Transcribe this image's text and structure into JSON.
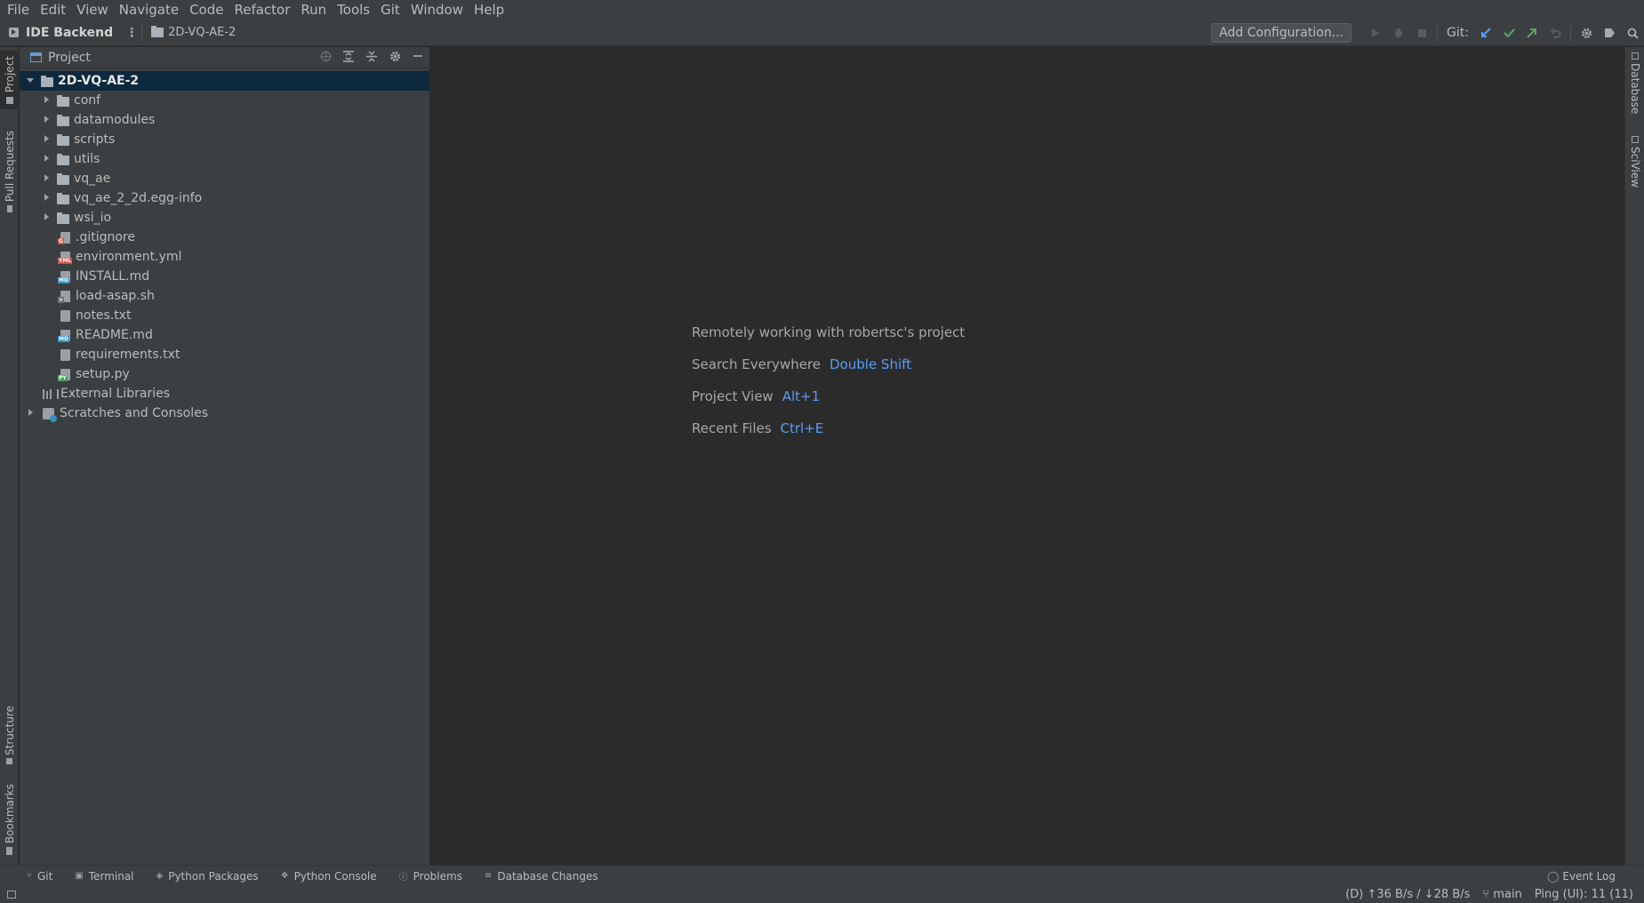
{
  "menu": [
    "File",
    "Edit",
    "View",
    "Navigate",
    "Code",
    "Refactor",
    "Run",
    "Tools",
    "Git",
    "Window",
    "Help"
  ],
  "navbar": {
    "backend_label": "IDE Backend",
    "kebab": "⋮",
    "breadcrumb": "2D-VQ-AE-2",
    "add_configuration": "Add Configuration...",
    "git_label": "Git:"
  },
  "left_stripe": {
    "project": "Project",
    "pull_requests": "Pull Requests",
    "structure": "Structure",
    "bookmarks": "Bookmarks"
  },
  "right_stripe": {
    "database": "Database",
    "sciview": "SciView"
  },
  "project_panel": {
    "title": "Project",
    "root": "2D-VQ-AE-2",
    "folders": [
      "conf",
      "datamodules",
      "scripts",
      "utils",
      "vq_ae",
      "vq_ae_2_2d.egg-info",
      "wsi_io"
    ],
    "files": [
      {
        "name": ".gitignore",
        "badge": "git"
      },
      {
        "name": "environment.yml",
        "badge": "yml"
      },
      {
        "name": "INSTALL.md",
        "badge": "md"
      },
      {
        "name": "load-asap.sh",
        "badge": "sh"
      },
      {
        "name": "notes.txt",
        "badge": ""
      },
      {
        "name": "README.md",
        "badge": "md"
      },
      {
        "name": "requirements.txt",
        "badge": ""
      },
      {
        "name": "setup.py",
        "badge": "py"
      }
    ],
    "external_libraries": "External Libraries",
    "scratches": "Scratches and Consoles"
  },
  "editor": {
    "remote_note": "Remotely working with robertsc's project",
    "hints": [
      {
        "label": "Search Everywhere",
        "shortcut": "Double Shift"
      },
      {
        "label": "Project View",
        "shortcut": "Alt+1"
      },
      {
        "label": "Recent Files",
        "shortcut": "Ctrl+E"
      }
    ]
  },
  "bottom_tools": {
    "git": "Git",
    "terminal": "Terminal",
    "python_packages": "Python Packages",
    "python_console": "Python Console",
    "problems": "Problems",
    "database_changes": "Database Changes",
    "event_log": "Event Log"
  },
  "status": {
    "traffic": "(D) ↑36 B/s / ↓28 B/s",
    "branch": "main",
    "ping": "Ping (UI): 11 (11)"
  },
  "colors": {
    "accent": "#589df6",
    "selection": "#0d293e",
    "panel_bg": "#3c3f41",
    "editor_bg": "#2b2b2b",
    "git_update": "#589df6",
    "git_commit": "#59a869",
    "git_push": "#59a869"
  }
}
